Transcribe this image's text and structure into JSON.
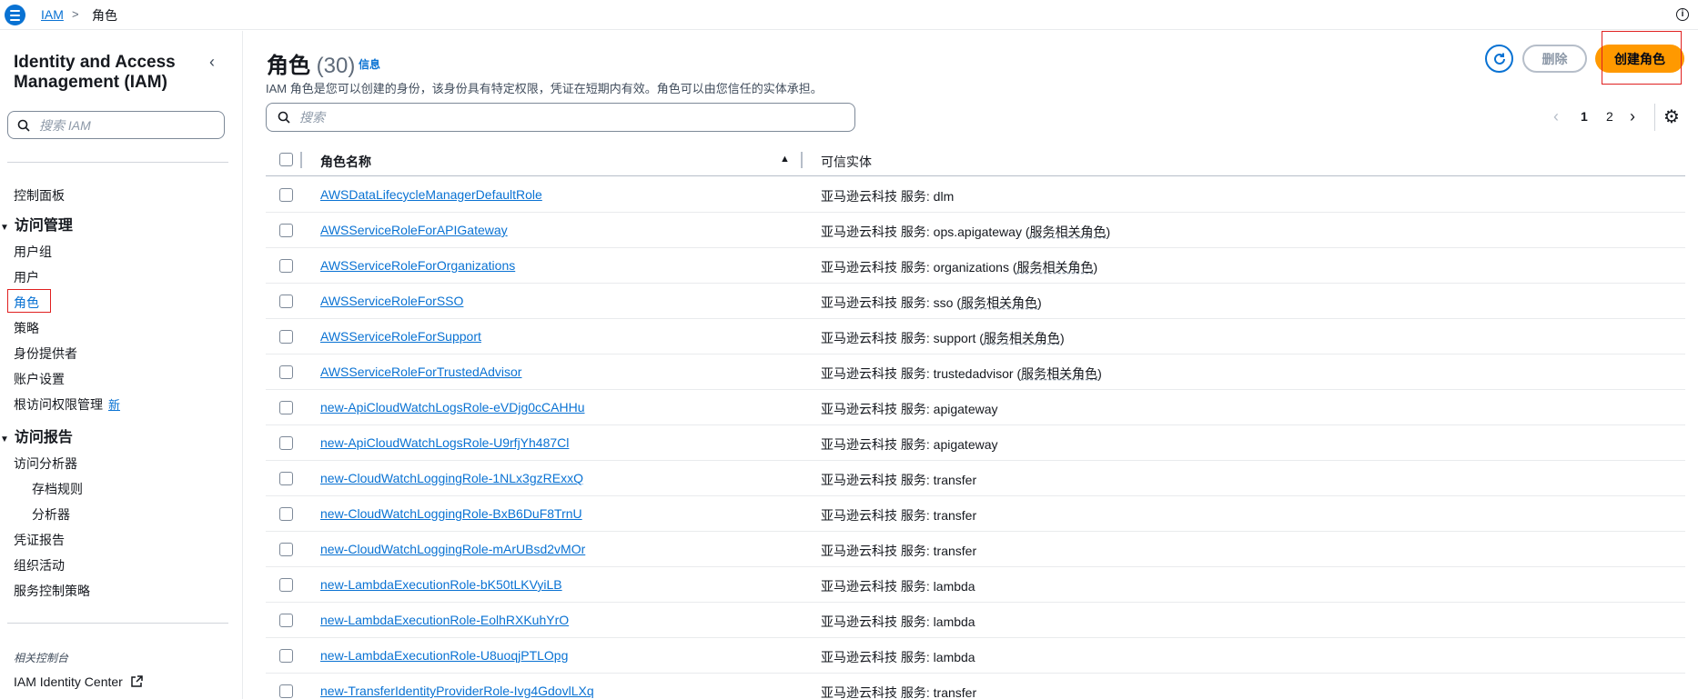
{
  "breadcrumb": {
    "root": "IAM",
    "current": "角色"
  },
  "sidebar": {
    "title": "Identity and Access Management (IAM)",
    "search_placeholder": "搜索 IAM",
    "dashboard": "控制面板",
    "access_management": {
      "label": "访问管理",
      "items": [
        "用户组",
        "用户",
        "角色",
        "策略",
        "身份提供者",
        "账户设置",
        "根访问权限管理"
      ],
      "new_badge": "新"
    },
    "access_reports": {
      "label": "访问报告",
      "analyzer": "访问分析器",
      "sub_items": [
        "存档规则",
        "分析器"
      ],
      "items": [
        "凭证报告",
        "组织活动",
        "服务控制策略"
      ]
    },
    "related_label": "相关控制台",
    "identity_center": "IAM Identity Center"
  },
  "main": {
    "title": "角色",
    "count": "(30)",
    "info": "信息",
    "description": "IAM 角色是您可以创建的身份，该身份具有特定权限，凭证在短期内有效。角色可以由您信任的实体承担。",
    "delete_label": "删除",
    "create_label": "创建角色",
    "search_placeholder": "搜索",
    "pages": [
      "1",
      "2"
    ]
  },
  "table": {
    "columns": [
      "角色名称",
      "可信实体"
    ],
    "rows": [
      {
        "name": "AWSDataLifecycleManagerDefaultRole",
        "entity": "亚马逊云科技 服务: dlm",
        "slr": ""
      },
      {
        "name": "AWSServiceRoleForAPIGateway",
        "entity": "亚马逊云科技 服务: ops.apigateway",
        "slr": "服务相关角色"
      },
      {
        "name": "AWSServiceRoleForOrganizations",
        "entity": "亚马逊云科技 服务: organizations",
        "slr": "服务相关角色"
      },
      {
        "name": "AWSServiceRoleForSSO",
        "entity": "亚马逊云科技 服务: sso",
        "slr": "服务相关角色"
      },
      {
        "name": "AWSServiceRoleForSupport",
        "entity": "亚马逊云科技 服务: support",
        "slr": "服务相关角色"
      },
      {
        "name": "AWSServiceRoleForTrustedAdvisor",
        "entity": "亚马逊云科技 服务: trustedadvisor",
        "slr": "服务相关角色"
      },
      {
        "name": "new-ApiCloudWatchLogsRole-eVDjg0cCAHHu",
        "entity": "亚马逊云科技 服务: apigateway",
        "slr": ""
      },
      {
        "name": "new-ApiCloudWatchLogsRole-U9rfjYh487Cl",
        "entity": "亚马逊云科技 服务: apigateway",
        "slr": ""
      },
      {
        "name": "new-CloudWatchLoggingRole-1NLx3gzRExxQ",
        "entity": "亚马逊云科技 服务: transfer",
        "slr": ""
      },
      {
        "name": "new-CloudWatchLoggingRole-BxB6DuF8TrnU",
        "entity": "亚马逊云科技 服务: transfer",
        "slr": ""
      },
      {
        "name": "new-CloudWatchLoggingRole-mArUBsd2vMOr",
        "entity": "亚马逊云科技 服务: transfer",
        "slr": ""
      },
      {
        "name": "new-LambdaExecutionRole-bK50tLKVyiLB",
        "entity": "亚马逊云科技 服务: lambda",
        "slr": ""
      },
      {
        "name": "new-LambdaExecutionRole-EolhRXKuhYrO",
        "entity": "亚马逊云科技 服务: lambda",
        "slr": ""
      },
      {
        "name": "new-LambdaExecutionRole-U8uoqjPTLOpg",
        "entity": "亚马逊云科技 服务: lambda",
        "slr": ""
      },
      {
        "name": "new-TransferIdentityProviderRole-Ivg4GdovlLXq",
        "entity": "亚马逊云科技 服务: transfer",
        "slr": ""
      }
    ]
  },
  "colors": {
    "accent": "#0972d3",
    "primary_button": "#ff9900",
    "highlight_box": "#e02020"
  }
}
